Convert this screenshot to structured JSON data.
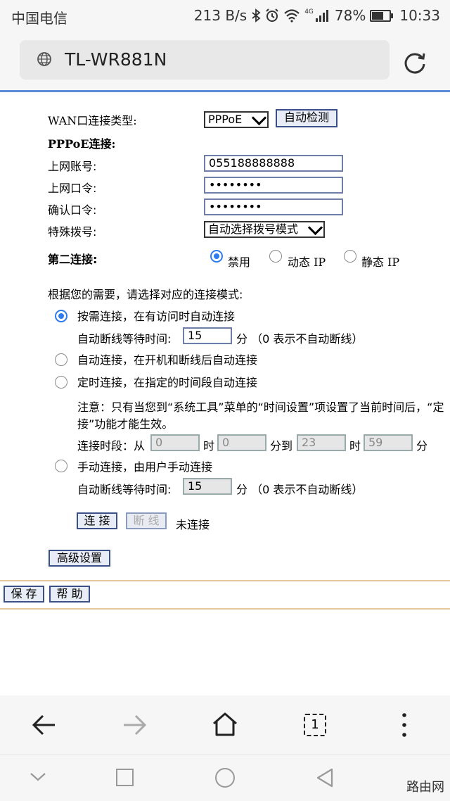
{
  "status_bar": {
    "carrier": "中国电信",
    "net_speed": "213 B/s",
    "network_type": "4G",
    "battery": "78%",
    "battery_level": 0.78,
    "time": "10:33"
  },
  "browser": {
    "url": "TL-WR881N"
  },
  "form": {
    "wan_type_label": "WAN口连接类型:",
    "wan_type_value": "PPPoE",
    "auto_detect_label": "自动检测",
    "pppoe_section": "PPPoE连接:",
    "account_label": "上网账号:",
    "account_value": "055188888888",
    "password_label": "上网口令:",
    "password_value": "••••••••",
    "confirm_label": "确认口令:",
    "confirm_value": "••••••••",
    "dial_label": "特殊拨号:",
    "dial_value": "自动选择拨号模式",
    "second_conn_label": "第二连接:",
    "second_options": [
      "禁用",
      "动态 IP",
      "静态 IP"
    ],
    "mode_prompt": "根据您的需要，请选择对应的连接模式:",
    "mode_on_demand": "按需连接，在有访问时自动连接",
    "idle_label_1": "自动断线等待时间:",
    "idle_value_1": "15",
    "idle_unit_1": "分 （0 表示不自动断线）",
    "mode_auto": "自动连接，在开机和断线后自动连接",
    "mode_timed": "定时连接，在指定的时间段自动连接",
    "note_line1": "注意：只有当您到“系统工具”菜单的“时间设置”项设置了当前时间后，“定",
    "note_line2": "接”功能才能生效。",
    "period_label": "连接时段：从",
    "period_from_hour": "0",
    "period_hour_text": "时",
    "period_from_min": "0",
    "period_to_text": "分到",
    "period_to_hour": "23",
    "period_hour_text2": "时",
    "period_to_min": "59",
    "period_min_text": "分",
    "mode_manual": "手动连接，由用户手动连接",
    "idle_label_2": "自动断线等待时间:",
    "idle_value_2": "15",
    "idle_unit_2": "分 （0 表示不自动断线）",
    "connect_label": "连 接",
    "disconnect_label": "断 线",
    "conn_status": "未连接",
    "advanced_label": "高级设置",
    "save_label": "保 存",
    "help_label": "帮 助"
  },
  "toolbar": {
    "tab_count": "1"
  },
  "watermark": "路由网",
  "colors": {
    "accent_blue": "#2d7cf0",
    "button_border": "#3b4f88",
    "url_divider": "#5b8ad6"
  }
}
